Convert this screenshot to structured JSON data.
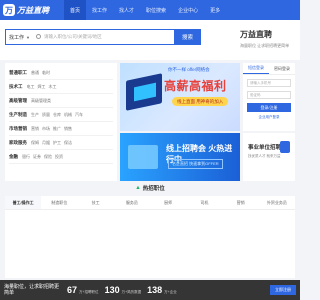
{
  "header": {
    "logo_text": "万益直聘",
    "nav": [
      "首页",
      "找工作",
      "找人才",
      "职位搜索",
      "企业中心",
      "更多"
    ]
  },
  "search": {
    "category": "找工作",
    "placeholder": "请输入职位/公司/关键词/地区",
    "button": "搜索",
    "brand_title": "万益直聘",
    "brand_sub": "海量职位 让求职招聘更简单"
  },
  "categories": [
    {
      "head": "普通职工",
      "subs": [
        "普通",
        "临时"
      ]
    },
    {
      "head": "技术工",
      "subs": [
        "电工",
        "焊工",
        "木工"
      ]
    },
    {
      "head": "高级管理",
      "subs": [
        "高级管理类"
      ]
    },
    {
      "head": "生产制造",
      "subs": [
        "生产",
        "质量",
        "仓库",
        "机械",
        "汽车"
      ]
    },
    {
      "head": "市场营销",
      "subs": [
        "营销",
        "市场",
        "推广",
        "销售"
      ]
    },
    {
      "head": "家政服务",
      "subs": [
        "保姆",
        "月嫂",
        "护工",
        "保洁"
      ]
    },
    {
      "head": "金融",
      "subs": [
        "银行",
        "证券",
        "保险",
        "投资"
      ]
    }
  ],
  "banner": {
    "top": "你不一样 offer网络会",
    "big": "高薪高福利",
    "pill": "线上直面 用神奇的加入"
  },
  "promo": {
    "title": "线上招聘会 火热进行中",
    "sub": "名企直招 快速拿到OFFER"
  },
  "login": {
    "tab1": "短信登录",
    "tab2": "密码登录",
    "input1": "请输入手机号",
    "input2": "验证码",
    "button": "登录/注册",
    "link": "企业用户登录"
  },
  "enterprise": {
    "title": "事业单位招聘",
    "sub": "找优质人才 就来万益"
  },
  "hot": {
    "title": "热招职位",
    "tabs": [
      "普工/操作工",
      "制造职位",
      "技工",
      "服务员",
      "厨师",
      "司机",
      "营销",
      "外贸业务员"
    ]
  },
  "bottom": {
    "text": "海量职位，让求职招聘更简单",
    "stats": [
      {
        "num": "67",
        "label": "万+招聘职位"
      },
      {
        "num": "130",
        "label": "万+简历数据"
      },
      {
        "num": "138",
        "label": "万+企业"
      }
    ],
    "button": "立即注册"
  },
  "colors": {
    "primary": "#2f67e0",
    "accent_red": "#e8413b",
    "bg": "#f2f4f7"
  }
}
